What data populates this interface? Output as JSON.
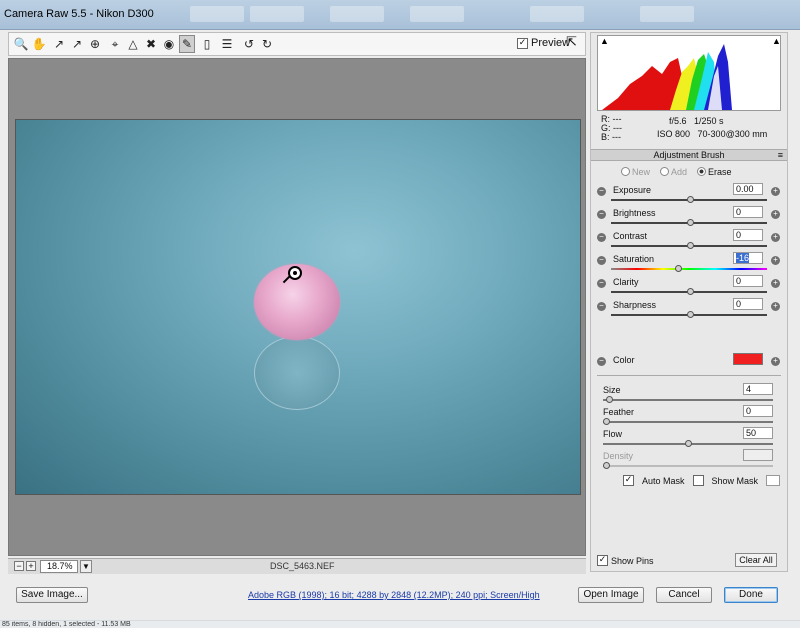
{
  "window": {
    "title": "Camera Raw 5.5  -  Nikon D300"
  },
  "toolbar": {
    "tools": [
      "zoom-tool-icon",
      "hand-tool-icon",
      "white-balance-icon",
      "color-sampler-icon",
      "target-adjust-icon",
      "crop-icon",
      "straighten-icon",
      "spot-removal-icon",
      "red-eye-icon",
      "adjustment-brush-icon",
      "graduated-filter-icon",
      "preferences-icon",
      "rotate-ccw-icon",
      "rotate-cw-icon"
    ],
    "preview_label": "Preview",
    "preview_checked": true
  },
  "status": {
    "zoom": "18.7%",
    "filename": "DSC_5463.NEF"
  },
  "info": {
    "r": "R:",
    "g": "G:",
    "b": "B:",
    "dash": "---",
    "aperture": "f/5.6",
    "shutter": "1/250 s",
    "iso": "ISO 800",
    "lens": "70-300@300 mm"
  },
  "panel": {
    "title": "Adjustment Brush",
    "mode_new": "New",
    "mode_add": "Add",
    "mode_erase": "Erase",
    "selected_mode": "Erase"
  },
  "adjustments": [
    {
      "label": "Exposure",
      "value": "0.00",
      "level": 0.5
    },
    {
      "label": "Brightness",
      "value": "0",
      "level": 0.5
    },
    {
      "label": "Contrast",
      "value": "0",
      "level": 0.5
    },
    {
      "label": "Saturation",
      "value": "-16",
      "level": 0.42
    },
    {
      "label": "Clarity",
      "value": "0",
      "level": 0.5
    },
    {
      "label": "Sharpness",
      "value": "0",
      "level": 0.5
    }
  ],
  "color": {
    "label": "Color",
    "swatch": "#f02020"
  },
  "brush": [
    {
      "label": "Size",
      "value": "4",
      "level": 0.02
    },
    {
      "label": "Feather",
      "value": "0",
      "level": 0.0
    },
    {
      "label": "Flow",
      "value": "50",
      "level": 0.5
    },
    {
      "label": "Density",
      "value": "",
      "level": 0.0
    }
  ],
  "automask": {
    "auto_label": "Auto Mask",
    "auto_checked": true,
    "show_label": "Show Mask",
    "show_checked": false
  },
  "pins": {
    "show_label": "Show Pins",
    "show_checked": true,
    "clear_label": "Clear All"
  },
  "footer": {
    "save": "Save Image...",
    "workflow": "Adobe RGB (1998); 16 bit; 4288 by 2848 (12.2MP); 240 ppi; Screen/High",
    "open": "Open Image",
    "cancel": "Cancel",
    "done": "Done"
  },
  "os_status": "85 items, 8 hidden, 1 selected - 11.53 MB"
}
